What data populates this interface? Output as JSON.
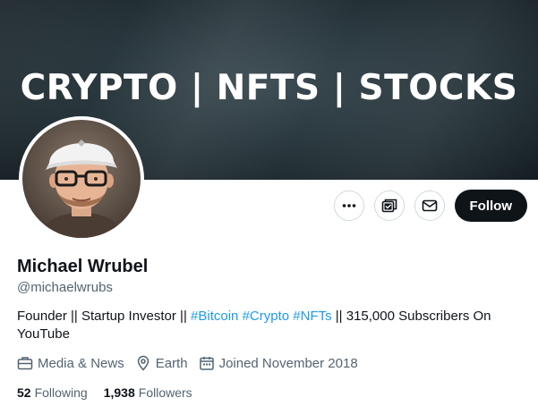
{
  "banner": {
    "text": "CRYPTO | NFTS | STOCKS"
  },
  "profile": {
    "display_name": "Michael Wrubel",
    "handle": "@michaelwrubs",
    "bio": {
      "prefix": "Founder || Startup Investor || ",
      "hashtags": [
        "#Bitcoin",
        "#Crypto",
        "#NFTs"
      ],
      "suffix": " || 315,000 Subscribers On YouTube"
    },
    "category": "Media & News",
    "location": "Earth",
    "joined": "Joined November 2018",
    "following_count": "52",
    "following_label": "Following",
    "followers_count": "1,938",
    "followers_label": "Followers"
  },
  "actions": {
    "more_icon": "more-horizontal-icon",
    "subscribe_icon": "subscription-icon",
    "message_icon": "mail-icon",
    "follow_label": "Follow"
  },
  "colors": {
    "link": "#1d9bf0",
    "text_primary": "#0f1419",
    "text_secondary": "#536471",
    "follow_bg": "#0f1419"
  }
}
